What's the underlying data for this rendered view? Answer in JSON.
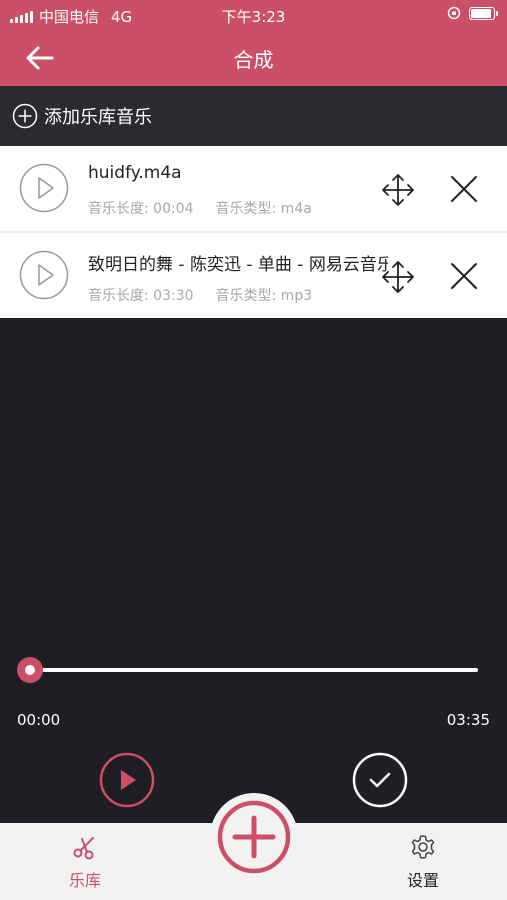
{
  "status_bar": {
    "carrier": "中国电信",
    "network": "4G",
    "time": "下午3:23",
    "battery_level": 0.9
  },
  "nav": {
    "title": "合成",
    "back_icon": "arrow-left-icon"
  },
  "add_library": {
    "label": "添加乐库音乐",
    "icon": "plus-circle-icon"
  },
  "tracks": [
    {
      "name": "huidfy.m4a",
      "length_label": "音乐长度: 00:04",
      "type_label": "音乐类型: m4a"
    },
    {
      "name": "致明日的舞 - 陈奕迅 - 单曲 - 网易云音乐",
      "length_label": "音乐长度: 03:30",
      "type_label": "音乐类型: mp3"
    }
  ],
  "player": {
    "current_time": "00:00",
    "total_time": "03:35",
    "progress": 0
  },
  "tabs": [
    {
      "label": "乐库",
      "icon": "scissors-icon",
      "active": true
    },
    {
      "label": "设置",
      "icon": "gear-icon",
      "active": false
    }
  ],
  "colors": {
    "brand": "#cc4f68",
    "background": "#1f1e24"
  }
}
